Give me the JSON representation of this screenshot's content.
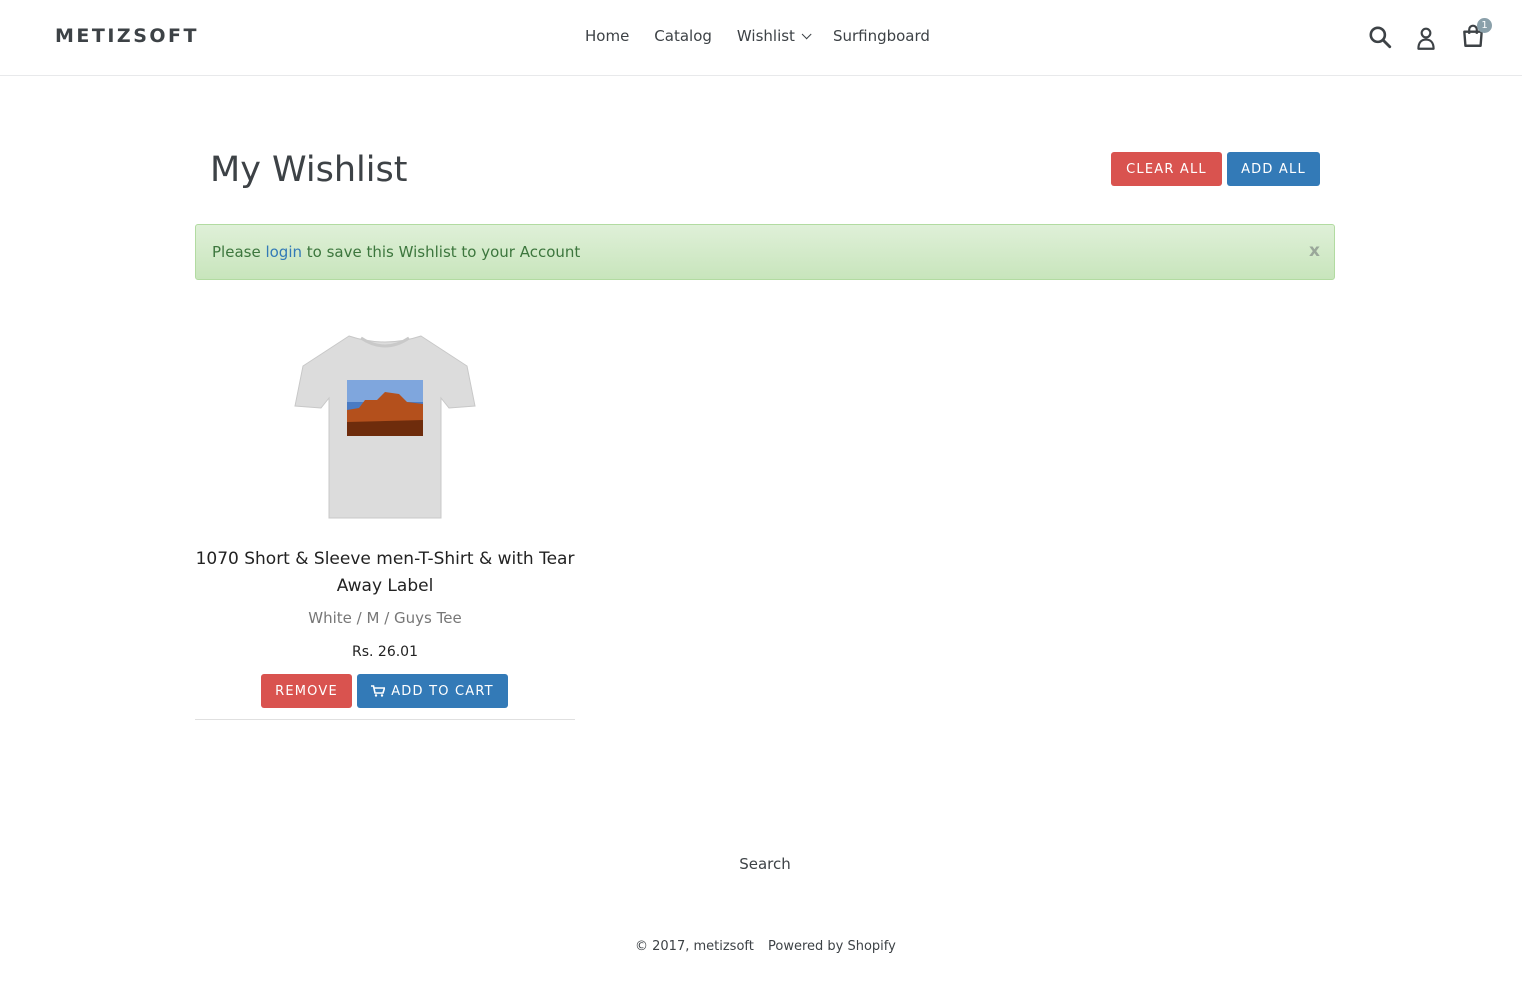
{
  "header": {
    "logo": "METIZSOFT",
    "nav": [
      {
        "label": "Home"
      },
      {
        "label": "Catalog"
      },
      {
        "label": "Wishlist"
      },
      {
        "label": "Surfingboard"
      }
    ],
    "cart_count": "1",
    "icons": [
      "search-icon",
      "account-icon",
      "cart-icon"
    ]
  },
  "page": {
    "title": "My Wishlist",
    "clear_all_label": "CLEAR ALL",
    "add_all_label": "ADD ALL"
  },
  "alert": {
    "prefix": "Please ",
    "link_text": "login",
    "suffix": " to save this Wishlist to your Account",
    "close_label": "x"
  },
  "items": [
    {
      "title": "1070 Short & Sleeve men-T-Shirt & with Tear Away Label",
      "variant": "White / M / Guys Tee",
      "price": "Rs. 26.01",
      "remove_label": "REMOVE",
      "add_to_cart_label": "ADD TO CART"
    }
  ],
  "footer": {
    "search_link": "Search",
    "copyright": "© 2017, metizsoft",
    "powered_by": "Powered by Shopify"
  },
  "colors": {
    "danger": "#d9534f",
    "primary": "#337ab7",
    "alert_bg": "#dff0d8",
    "alert_text": "#3c763d",
    "text": "#3d4246"
  }
}
